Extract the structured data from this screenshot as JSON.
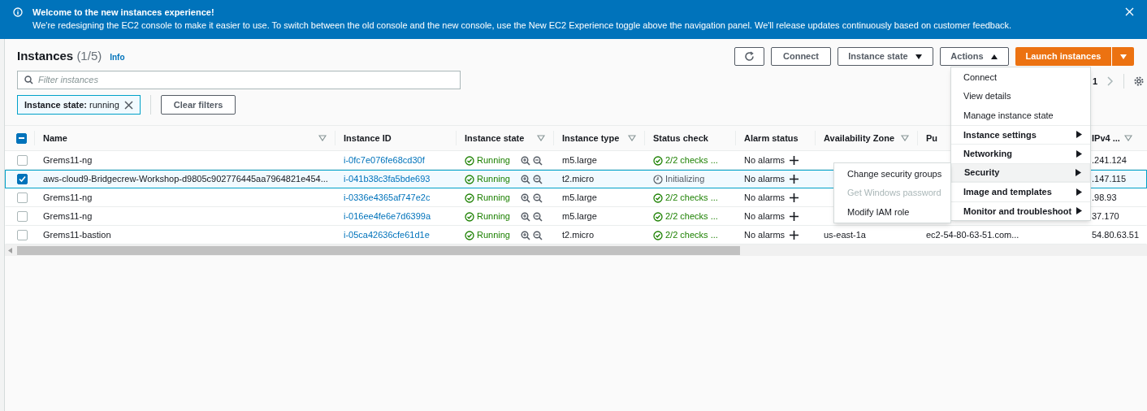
{
  "banner": {
    "title": "Welcome to the new instances experience!",
    "text": "We're redesigning the EC2 console to make it easier to use. To switch between the old console and the new console, use the New EC2 Experience toggle above the navigation panel. We'll release updates continuously based on customer feedback."
  },
  "header": {
    "title": "Instances",
    "count": "(1/5)",
    "info": "Info"
  },
  "toolbar": {
    "connect": "Connect",
    "instance_state": "Instance state",
    "actions": "Actions",
    "actions_expanded": true,
    "launch": "Launch instances"
  },
  "filter": {
    "placeholder": "Filter instances",
    "token_key": "Instance state:",
    "token_value": "running",
    "clear": "Clear filters"
  },
  "pagination": {
    "page": "1"
  },
  "table": {
    "select_all": {
      "indeterminate": true
    },
    "columns": [
      {
        "label": "Name",
        "sortable": true
      },
      {
        "label": "Instance ID",
        "sortable": false
      },
      {
        "label": "Instance state",
        "sortable": true
      },
      {
        "label": "Instance type",
        "sortable": true
      },
      {
        "label": "Status check",
        "sortable": false
      },
      {
        "label": "Alarm status",
        "sortable": false
      },
      {
        "label": "Availability Zone",
        "sortable": true
      },
      {
        "label": "Pu",
        "sortable": false
      },
      {
        "label": "IPv4 ...",
        "sortable": true
      }
    ],
    "rows": [
      {
        "selected": false,
        "name": "Grems11-ng",
        "id": "i-0fc7e076fe68cd30f",
        "state": "Running",
        "type": "m5.large",
        "status": {
          "kind": "ok",
          "text": "2/2 checks ..."
        },
        "alarm": "No alarms",
        "ip": ".241.124"
      },
      {
        "selected": true,
        "name": "aws-cloud9-Bridgecrew-Workshop-d9805c902776445aa7964821e454...",
        "id": "i-041b38c3fa5bde693",
        "state": "Running",
        "type": "t2.micro",
        "status": {
          "kind": "pending",
          "text": "Initializing"
        },
        "alarm": "No alarms",
        "ip": ".147.115"
      },
      {
        "selected": false,
        "name": "Grems11-ng",
        "id": "i-0336e4365af747e2c",
        "state": "Running",
        "type": "m5.large",
        "status": {
          "kind": "ok",
          "text": "2/2 checks ..."
        },
        "alarm": "No alarms",
        "ip": ".98.93"
      },
      {
        "selected": false,
        "name": "Grems11-ng",
        "id": "i-016ee4fe6e7d6399a",
        "state": "Running",
        "type": "m5.large",
        "status": {
          "kind": "ok",
          "text": "2/2 checks ..."
        },
        "alarm": "No alarms",
        "ip": "37.170"
      },
      {
        "selected": false,
        "name": "Grems11-bastion",
        "id": "i-05ca42636cfe61d1e",
        "state": "Running",
        "type": "t2.micro",
        "status": {
          "kind": "ok",
          "text": "2/2 checks ..."
        },
        "alarm": "No alarms",
        "az": "us-east-1a",
        "dns": "ec2-54-80-63-51.com...",
        "ip": "54.80.63.51"
      }
    ]
  },
  "actions_menu": [
    {
      "label": "Connect",
      "submenu": false,
      "selected": false,
      "group_start": false
    },
    {
      "label": "View details",
      "submenu": false,
      "selected": false,
      "group_start": false
    },
    {
      "label": "Manage instance state",
      "submenu": false,
      "selected": false,
      "group_start": false
    },
    {
      "label": "Instance settings",
      "submenu": true,
      "selected": false,
      "group_start": true
    },
    {
      "label": "Networking",
      "submenu": true,
      "selected": false,
      "group_start": true
    },
    {
      "label": "Security",
      "submenu": true,
      "selected": true,
      "group_start": true
    },
    {
      "label": "Image and templates",
      "submenu": true,
      "selected": false,
      "group_start": true
    },
    {
      "label": "Monitor and troubleshoot",
      "submenu": true,
      "selected": false,
      "group_start": true
    }
  ],
  "security_submenu": [
    {
      "label": "Change security groups",
      "disabled": false
    },
    {
      "label": "Get Windows password",
      "disabled": true
    },
    {
      "label": "Modify IAM role",
      "disabled": false
    }
  ]
}
